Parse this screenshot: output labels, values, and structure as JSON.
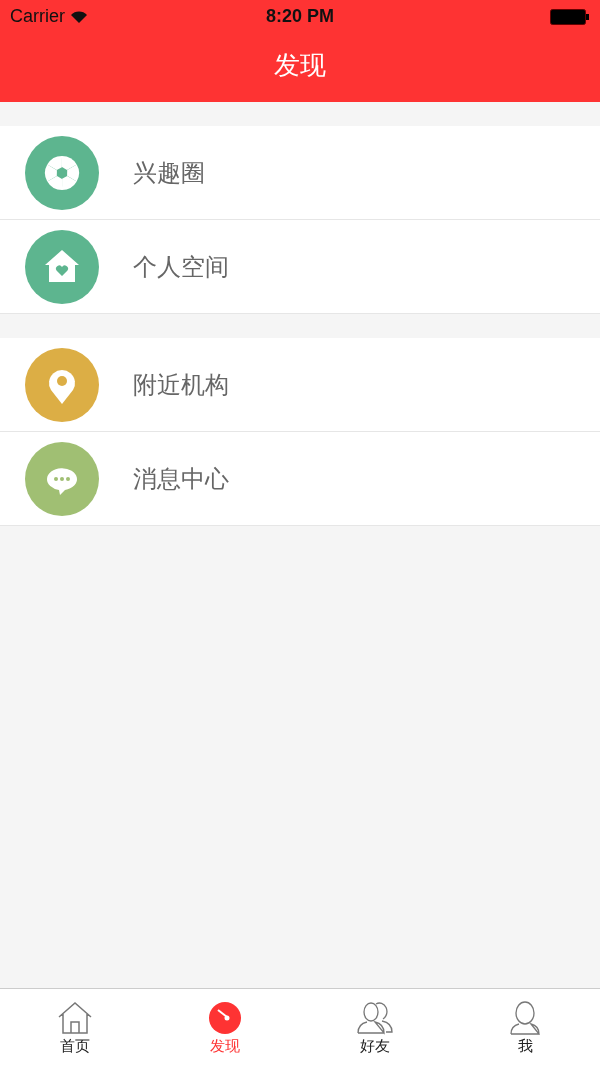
{
  "status_bar": {
    "carrier": "Carrier",
    "time": "8:20 PM"
  },
  "header": {
    "title": "发现"
  },
  "groups": [
    {
      "items": [
        {
          "label": "兴趣圈",
          "color": "#5db58f"
        },
        {
          "label": "个人空间",
          "color": "#5db58f"
        }
      ]
    },
    {
      "items": [
        {
          "label": "附近机构",
          "color": "#dcae45"
        },
        {
          "label": "消息中心",
          "color": "#a0bf73"
        }
      ]
    }
  ],
  "tab_bar": [
    {
      "label": "首页",
      "selected": false
    },
    {
      "label": "发现",
      "selected": true
    },
    {
      "label": "好友",
      "selected": false
    },
    {
      "label": "我",
      "selected": false
    }
  ]
}
